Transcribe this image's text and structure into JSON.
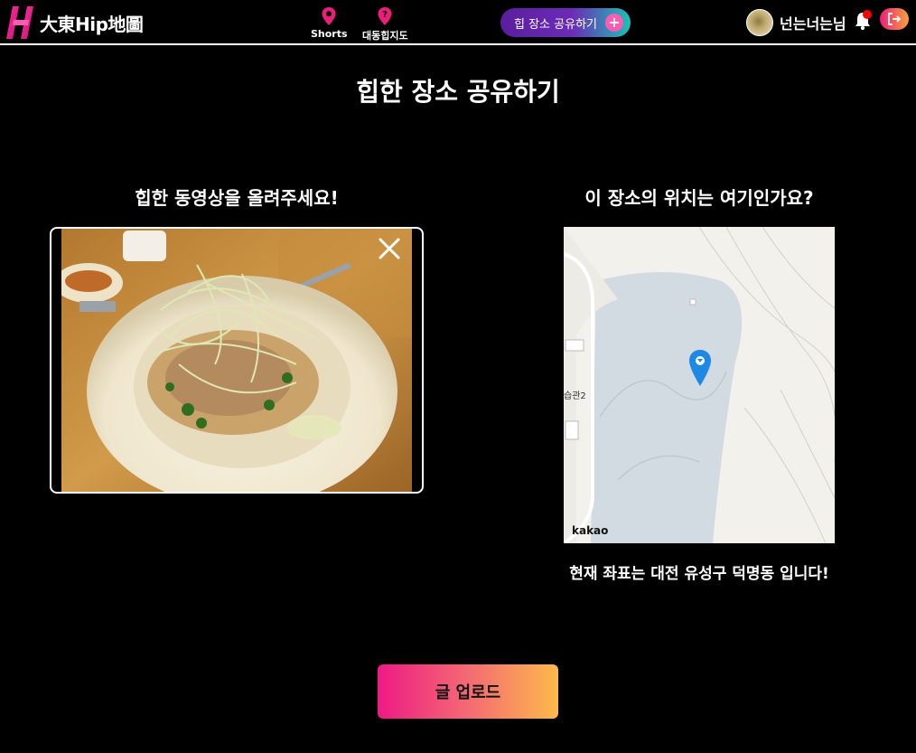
{
  "header": {
    "logo_text": "大東Hip地圖",
    "nav": [
      {
        "label": "Shorts",
        "icon": "location-pin-icon"
      },
      {
        "label": "대동힙지도",
        "icon": "question-pin-icon"
      }
    ],
    "share_button_label": "힙 장소 공유하기",
    "share_button_icon": "plus-icon",
    "user_name": "넌는너는님",
    "accent_pink": "#ee1d7a"
  },
  "main": {
    "title": "힙한 장소 공유하기",
    "left": {
      "heading": "힙한 동영상을 올려주세요!"
    },
    "right": {
      "heading": "이 장소의 위치는 여기인가요?",
      "map_brand": "kakao",
      "map_label": "습관2",
      "coordinate_text": "현재 좌표는 대전 유성구 덕명동 입니다!"
    },
    "upload_button_label": "글 업로드"
  }
}
